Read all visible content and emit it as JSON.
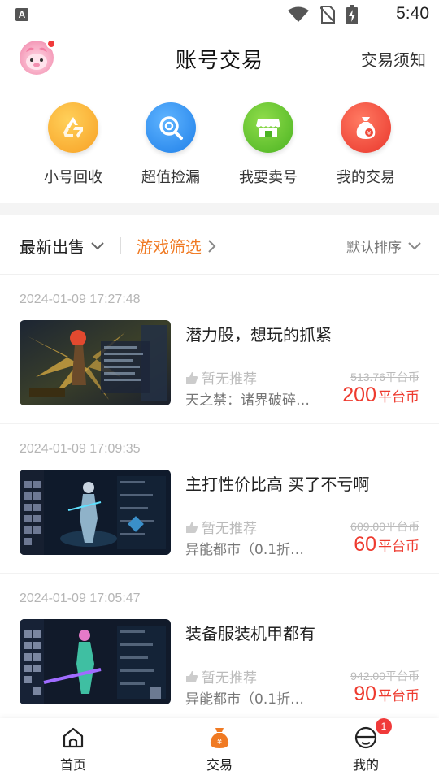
{
  "status_bar": {
    "time": "5:40",
    "app_glyph": "A",
    "icons": [
      "wifi-icon",
      "no-sim-icon",
      "battery-charging-icon"
    ]
  },
  "header": {
    "title": "账号交易",
    "notice_link": "交易须知",
    "avatar": "avatar-icon",
    "badge_color": "#f03a3a"
  },
  "quick_actions": [
    {
      "label": "小号回收",
      "icon": "recycle-icon",
      "color": "#f9a52a"
    },
    {
      "label": "超值捡漏",
      "icon": "magnifier-icon",
      "color": "#2c8ff0"
    },
    {
      "label": "我要卖号",
      "icon": "shop-icon",
      "color": "#5bc02a"
    },
    {
      "label": "我的交易",
      "icon": "money-bag-icon",
      "color": "#f04a3a"
    }
  ],
  "filters": {
    "latest": "最新出售",
    "game_filter": "游戏筛选",
    "sort": "默认排序",
    "accent_color": "#f07a23"
  },
  "listings": [
    {
      "time": "2024-01-09 17:27:48",
      "title": "潜力股，想玩的抓紧",
      "recommend": "暂无推荐",
      "game": "天之禁：诸界破碎（送...",
      "original_price": "513.76平台币",
      "price": "200",
      "unit": "平台币"
    },
    {
      "time": "2024-01-09 17:09:35",
      "title": "主打性价比高 买了不亏啊",
      "recommend": "暂无推荐",
      "game": "异能都市（0.1折抹零...",
      "original_price": "609.00平台币",
      "price": "60",
      "unit": "平台币"
    },
    {
      "time": "2024-01-09 17:05:47",
      "title": "装备服装机甲都有",
      "recommend": "暂无推荐",
      "game": "异能都市（0.1折抹零...",
      "original_price": "942.00平台币",
      "price": "90",
      "unit": "平台币"
    }
  ],
  "price_color": "#ee3b2f",
  "bottom_nav": [
    {
      "label": "首页",
      "icon": "home-icon"
    },
    {
      "label": "交易",
      "icon": "trade-bag-icon",
      "color": "#f07a23"
    },
    {
      "label": "我的",
      "icon": "profile-icon",
      "badge": "1"
    }
  ]
}
